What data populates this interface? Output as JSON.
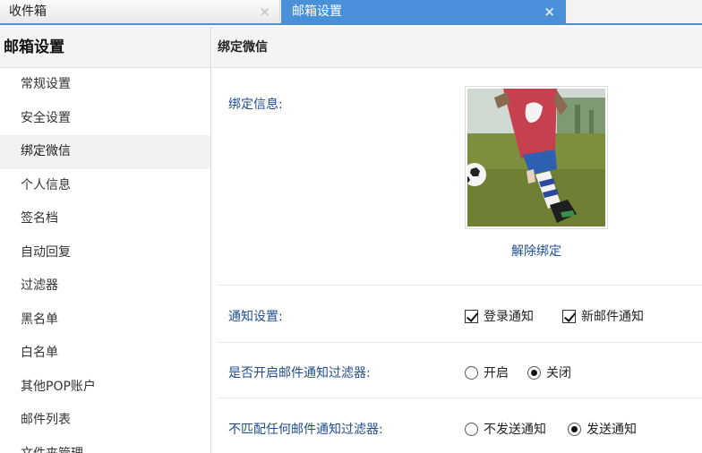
{
  "tabs": [
    {
      "label": "收件箱",
      "close": "×"
    },
    {
      "label": "邮箱设置",
      "close": "×"
    }
  ],
  "sidebar": {
    "title": "邮箱设置",
    "items": [
      {
        "label": "常规设置"
      },
      {
        "label": "安全设置"
      },
      {
        "label": "绑定微信"
      },
      {
        "label": "个人信息"
      },
      {
        "label": "签名档"
      },
      {
        "label": "自动回复"
      },
      {
        "label": "过滤器"
      },
      {
        "label": "黑名单"
      },
      {
        "label": "白名单"
      },
      {
        "label": "其他POP账户"
      },
      {
        "label": "邮件列表"
      },
      {
        "label": "文件夹管理"
      }
    ],
    "active_item": "绑定微信"
  },
  "main": {
    "section_title": "绑定微信",
    "bind_info_label": "绑定信息:",
    "avatar_icon": "avatar-photo-soccer-child",
    "unbind_label": "解除绑定",
    "notify": {
      "label": "通知设置:",
      "options": [
        {
          "label": "登录通知",
          "checked": true
        },
        {
          "label": "新邮件通知",
          "checked": true
        }
      ]
    },
    "filter_enable": {
      "label": "是否开启邮件通知过滤器:",
      "options": [
        {
          "label": "开启",
          "checked": false
        },
        {
          "label": "关闭",
          "checked": true
        }
      ]
    },
    "no_match": {
      "label": "不匹配任何邮件通知过滤器:",
      "options": [
        {
          "label": "不发送通知",
          "checked": false
        },
        {
          "label": "发送通知",
          "checked": true
        }
      ]
    }
  },
  "colors": {
    "accent": "#4a90d9",
    "label_blue": "#1f4e8c"
  }
}
